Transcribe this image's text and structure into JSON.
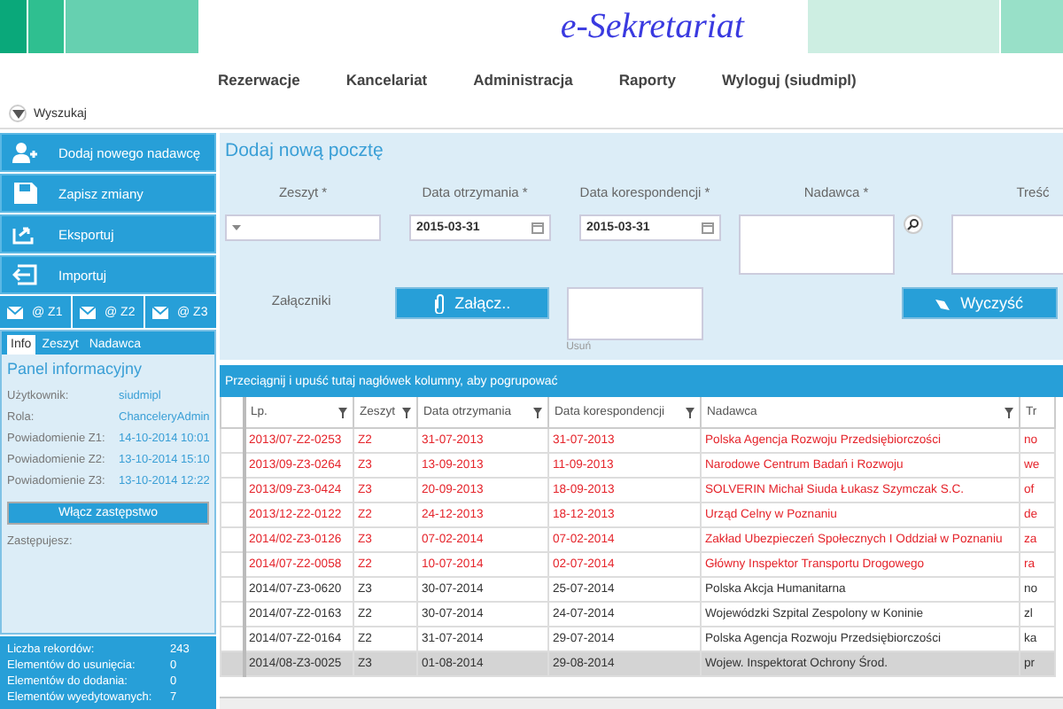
{
  "header": {
    "logo": "e-Sekretariat"
  },
  "nav": [
    "Rezerwacje",
    "Kancelariat",
    "Administracja",
    "Raporty",
    "Wyloguj (siudmipl)"
  ],
  "search_toggle": {
    "label": "Wyszukaj",
    "expanded": false
  },
  "sidebar": {
    "actions": [
      {
        "kind": "add-sender",
        "label": "Dodaj nowego nadawcę"
      },
      {
        "kind": "save",
        "label": "Zapisz zmiany"
      },
      {
        "kind": "export",
        "label": "Eksportuj"
      },
      {
        "kind": "import",
        "label": "Importuj"
      }
    ],
    "mail_buttons": [
      "@ Z1",
      "@ Z2",
      "@ Z3"
    ],
    "tabs": [
      {
        "label": "Info",
        "selected": true
      },
      {
        "label": "Zeszyt",
        "selected": false
      },
      {
        "label": "Nadawca",
        "selected": false
      }
    ],
    "panel_title": "Panel informacyjny",
    "info": [
      {
        "label": "Użytkownik:",
        "value": "siudmipl"
      },
      {
        "label": "Rola:",
        "value": "ChanceleryAdmin"
      },
      {
        "label": "Powiadomienie Z1:",
        "value": "14-10-2014 10:01"
      },
      {
        "label": "Powiadomienie Z2:",
        "value": "13-10-2014 15:10"
      },
      {
        "label": "Powiadomienie Z3:",
        "value": "13-10-2014 12:22"
      }
    ],
    "substitute_button": "Włącz zastępstwo",
    "substituting_label": "Zastępujesz:",
    "stats": [
      {
        "label": "Liczba rekordów:",
        "value": "243"
      },
      {
        "label": "Elementów do usunięcia:",
        "value": "0"
      },
      {
        "label": "Elementów do dodania:",
        "value": "0"
      },
      {
        "label": "Elementów wyedytowanych:",
        "value": "7"
      }
    ]
  },
  "form": {
    "title": "Dodaj nową pocztę",
    "fields": [
      {
        "label": "Zeszyt *",
        "kind": "dropdown"
      },
      {
        "label": "Data otrzymania *",
        "kind": "date",
        "value": "2015-03-31"
      },
      {
        "label": "Data korespondencji *",
        "kind": "date",
        "value": "2015-03-31"
      },
      {
        "label": "Nadawca *",
        "kind": "textarea"
      },
      {
        "label": "Treść",
        "kind": "textarea"
      }
    ],
    "attachments_label": "Załączniki",
    "attach_button": "Załącz..",
    "remove_link": "Usuń",
    "clear_button": "Wyczyść"
  },
  "table": {
    "group_hint": "Przeciągnij i upuść tutaj nagłówek kolumny, aby pogrupować",
    "columns": [
      "Lp.",
      "Zeszyt",
      "Data otrzymania",
      "Data korespondencji",
      "Nadawca",
      "Tr"
    ],
    "rows": [
      {
        "cells": [
          "2013/07-Z2-0253",
          "Z2",
          "31-07-2013",
          "31-07-2013",
          "Polska Agencja Rozwoju Przedsiębiorczości",
          "no"
        ],
        "overdue": true,
        "selected": false
      },
      {
        "cells": [
          "2013/09-Z3-0264",
          "Z3",
          "13-09-2013",
          "11-09-2013",
          "Narodowe Centrum Badań i Rozwoju",
          "we"
        ],
        "overdue": true,
        "selected": false
      },
      {
        "cells": [
          "2013/09-Z3-0424",
          "Z3",
          "20-09-2013",
          "18-09-2013",
          "SOLVERIN Michał Siuda Łukasz Szymczak S.C.",
          "of"
        ],
        "overdue": true,
        "selected": false
      },
      {
        "cells": [
          "2013/12-Z2-0122",
          "Z2",
          "24-12-2013",
          "18-12-2013",
          "Urząd Celny w Poznaniu",
          "de"
        ],
        "overdue": true,
        "selected": false
      },
      {
        "cells": [
          "2014/02-Z3-0126",
          "Z3",
          "07-02-2014",
          "07-02-2014",
          "Zakład Ubezpieczeń Społecznych I Oddział w Poznaniu",
          "za"
        ],
        "overdue": true,
        "selected": false
      },
      {
        "cells": [
          "2014/07-Z2-0058",
          "Z2",
          "10-07-2014",
          "02-07-2014",
          "Główny Inspektor Transportu Drogowego",
          "ra"
        ],
        "overdue": true,
        "selected": false
      },
      {
        "cells": [
          "2014/07-Z3-0620",
          "Z3",
          "30-07-2014",
          "25-07-2014",
          "Polska Akcja Humanitarna",
          "no"
        ],
        "overdue": false,
        "selected": false
      },
      {
        "cells": [
          "2014/07-Z2-0163",
          "Z2",
          "30-07-2014",
          "24-07-2014",
          "Wojewódzki Szpital Zespolony w Koninie",
          "zl"
        ],
        "overdue": false,
        "selected": false
      },
      {
        "cells": [
          "2014/07-Z2-0164",
          "Z2",
          "31-07-2014",
          "29-07-2014",
          "Polska Agencja Rozwoju Przedsiębiorczości",
          "ka"
        ],
        "overdue": false,
        "selected": false
      },
      {
        "cells": [
          "2014/08-Z3-0025",
          "Z3",
          "01-08-2014",
          "29-08-2014",
          "Wojew. Inspektorat Ochrony Środ.",
          "pr"
        ],
        "overdue": false,
        "selected": true
      }
    ]
  }
}
